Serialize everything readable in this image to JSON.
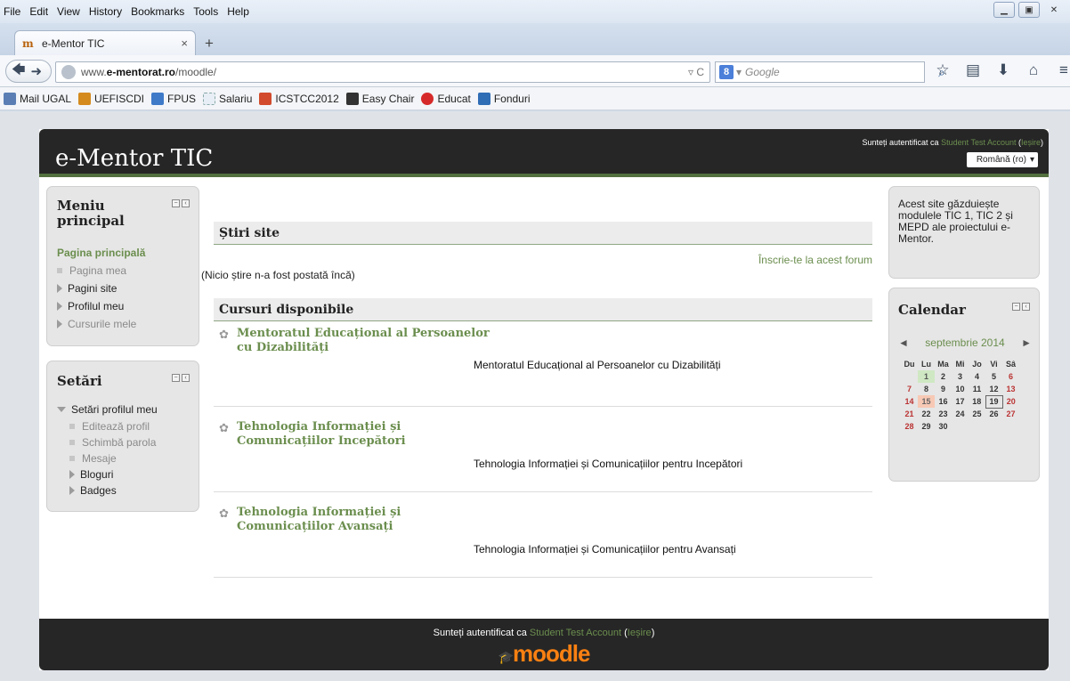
{
  "browser": {
    "menu": [
      "File",
      "Edit",
      "View",
      "History",
      "Bookmarks",
      "Tools",
      "Help"
    ],
    "tab_title": "e-Mentor TIC",
    "url_prefix": "www.",
    "url_host": "e-mentorat.ro",
    "url_path": "/moodle/",
    "search_placeholder": "Google",
    "bookmarks": [
      {
        "label": "Mail UGAL",
        "color": "#5b7fb5"
      },
      {
        "label": "UEFISCDI",
        "color": "#d58a1e"
      },
      {
        "label": "FPUS",
        "color": "#3f7ac8"
      },
      {
        "label": "Salariu",
        "color": "#e8eef5"
      },
      {
        "label": "ICSTCC2012",
        "color": "#d14b2c"
      },
      {
        "label": "Easy Chair",
        "color": "#333333"
      },
      {
        "label": "Educat",
        "color": "#d62a2a"
      },
      {
        "label": "Fonduri",
        "color": "#2f6db5"
      }
    ]
  },
  "site": {
    "title": "e-Mentor TIC",
    "login_prefix": "Sunteți autentificat ca",
    "user": "Student Test Account",
    "logout": "Ieșire",
    "language": "Română (ro)"
  },
  "menu_block": {
    "title": "Meniu principal",
    "home": "Pagina principală",
    "items": [
      "Pagina mea",
      "Pagini site",
      "Profilul meu",
      "Cursurile mele"
    ]
  },
  "settings_block": {
    "title": "Setări",
    "profile_settings": "Setări profilul meu",
    "items": [
      "Editează profil",
      "Schimbă parola",
      "Mesaje",
      "Bloguri",
      "Badges"
    ]
  },
  "news": {
    "title": "Știri site",
    "subscribe": "Înscrie-te la acest forum",
    "empty": "(Nicio știre n-a fost postată încă)"
  },
  "courses": {
    "title": "Cursuri disponibile",
    "items": [
      {
        "name_line1": "Mentoratul Educațional al Persoanelor",
        "name_line2": "cu Dizabilități",
        "desc": "Mentoratul Educațional al Persoanelor cu Dizabilități"
      },
      {
        "name_line1": "Tehnologia Informației și",
        "name_line2": "Comunicațiilor Incepători",
        "desc": "Tehnologia Informației și Comunicațiilor pentru Incepători"
      },
      {
        "name_line1": "Tehnologia Informației și",
        "name_line2": "Comunicațiilor Avansați",
        "desc": "Tehnologia Informației și Comunicațiilor pentru Avansați"
      }
    ]
  },
  "about": {
    "text": "Acest site găzduiește modulele TIC 1, TIC 2 și MEPD ale proiectului e-Mentor."
  },
  "calendar": {
    "title": "Calendar",
    "month": "septembrie 2014",
    "days": [
      "Du",
      "Lu",
      "Ma",
      "Mi",
      "Jo",
      "Vi",
      "Sâ"
    ],
    "weeks": [
      [
        "",
        "1",
        "2",
        "3",
        "4",
        "5",
        "6"
      ],
      [
        "7",
        "8",
        "9",
        "10",
        "11",
        "12",
        "13"
      ],
      [
        "14",
        "15",
        "16",
        "17",
        "18",
        "19",
        "20"
      ],
      [
        "21",
        "22",
        "23",
        "24",
        "25",
        "26",
        "27"
      ],
      [
        "28",
        "29",
        "30",
        "",
        "",
        "",
        ""
      ]
    ]
  },
  "footer": {
    "login_prefix": "Sunteți autentificat ca",
    "user": "Student Test Account",
    "logout": "Ieșire",
    "logo": "moodle"
  },
  "colors": {
    "accent_green": "#6b8e4e",
    "header_dark": "#262626",
    "moodle_orange": "#f98012"
  }
}
